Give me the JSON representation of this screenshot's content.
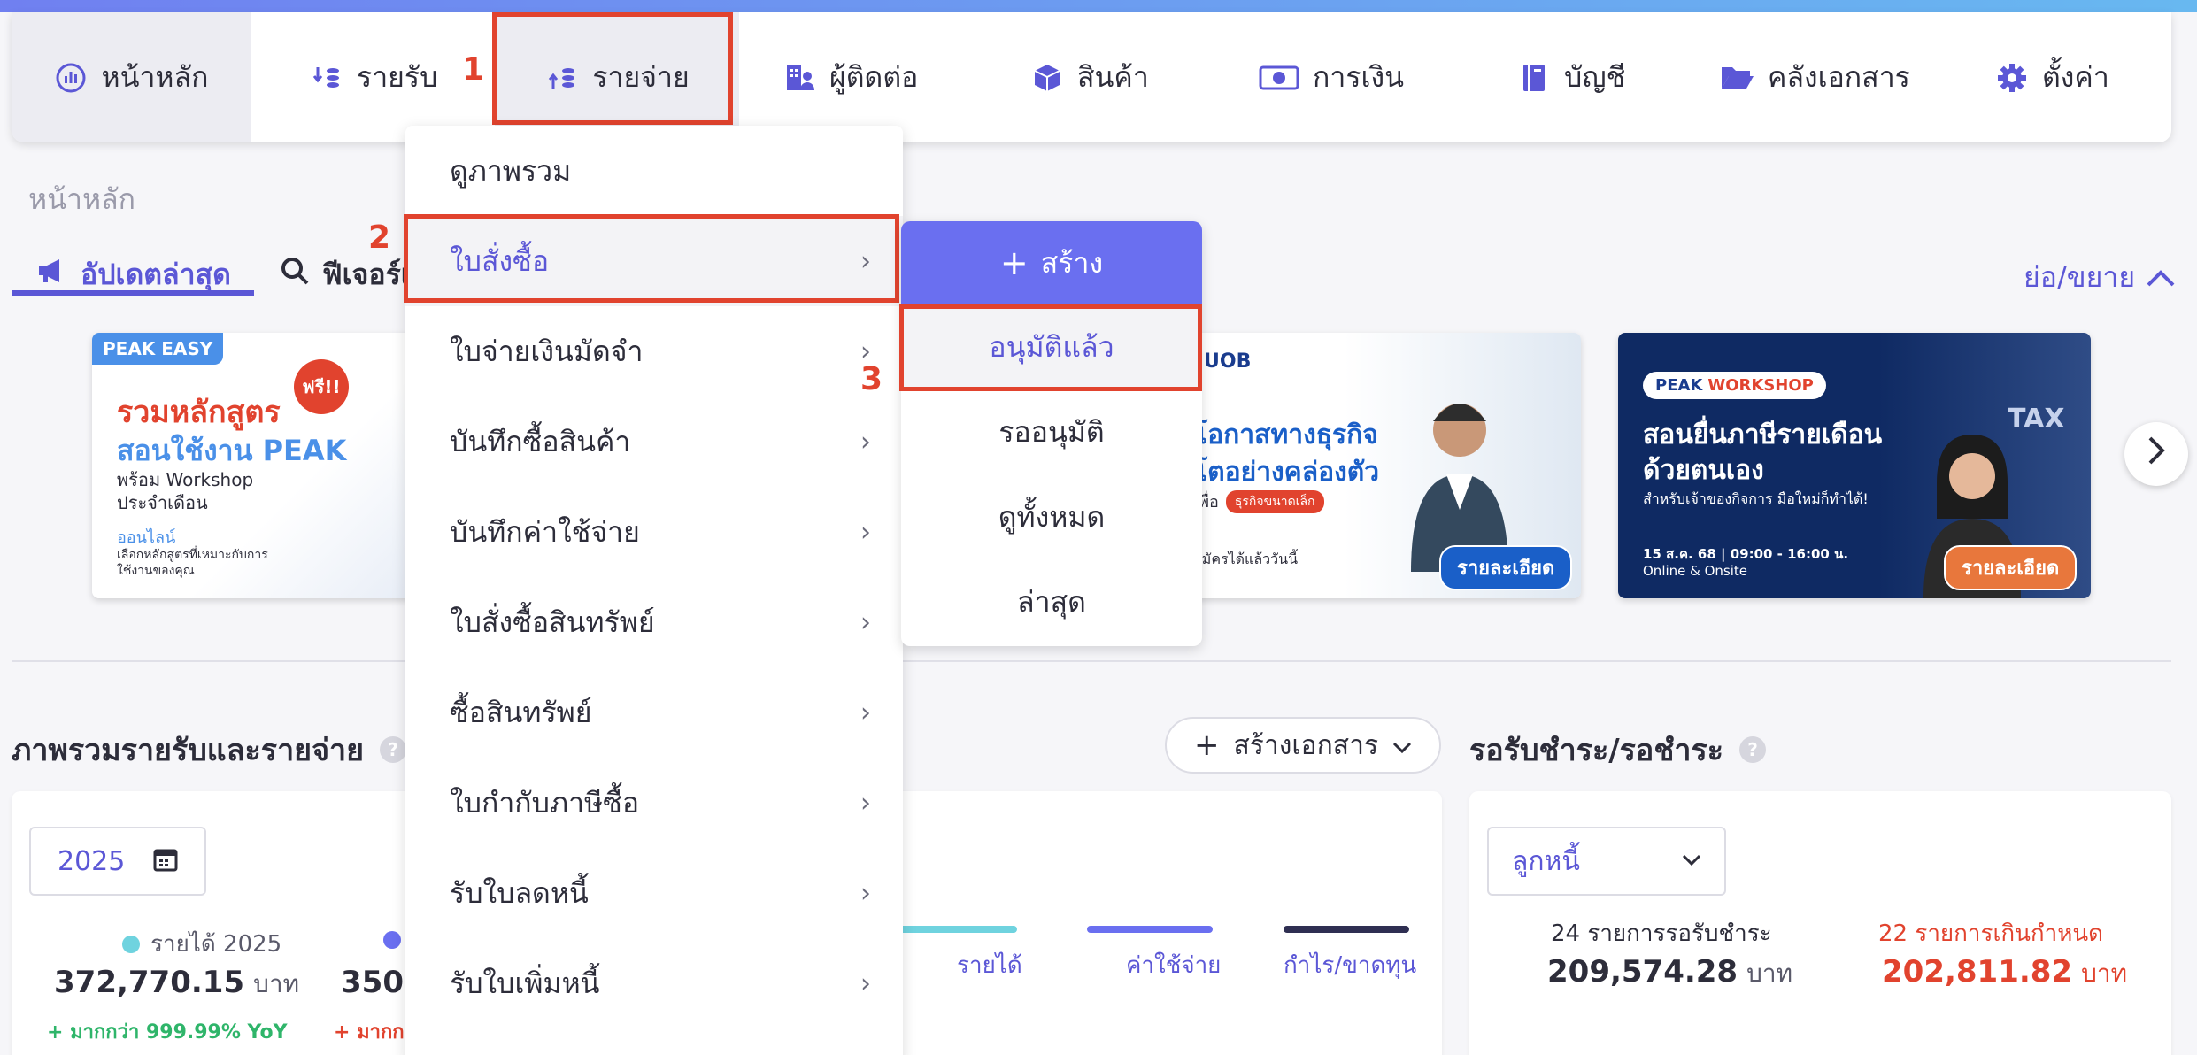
{
  "nav": {
    "home": "หน้าหลัก",
    "income": "รายรับ",
    "expense": "รายจ่าย",
    "contacts": "ผู้ติดต่อ",
    "products": "สินค้า",
    "finance": "การเงิน",
    "accounts": "บัญชี",
    "documents": "คลังเอกสาร",
    "settings": "ตั้งค่า"
  },
  "markers": [
    "1",
    "2",
    "3"
  ],
  "breadcrumb": "หน้าหลัก",
  "tabs": {
    "updates": "อัปเดตล่าสุด",
    "features": "ฟีเจอร์เ"
  },
  "collapse_label": "ย่อ/ขยาย",
  "banners": {
    "b1": {
      "tag": "PEAK EASY",
      "free": "ฟรี!!",
      "title1": "รวมหลักสูตร",
      "title2": "สอนใช้งาน PEAK",
      "sub1": "พร้อม Workshop",
      "sub2": "ประจำเดือน",
      "online": "ออนไลน์",
      "desc1": "เลือกหลักสูตรที่เหมาะกับการ",
      "desc2": "ใช้งานของคุณ"
    },
    "b3": {
      "logo": "UOB",
      "line1": "โอกาสทางธุรกิจ",
      "line2": "โตอย่างคล่องตัว",
      "line3": "เพื่อ",
      "pill": "ธุรกิจขนาดเล็ก",
      "line4": "สมัครได้แล้ววันนี้",
      "detail": "รายละเอียด"
    },
    "b4": {
      "tag_peak": "PEAK",
      "tag_ws": "WORKSHOP",
      "title1": "สอนยื่นภาษีรายเดือน",
      "title2": "ด้วยตนเอง",
      "sub": "สำหรับเจ้าของกิจการ มือใหม่ก็ทำได้!",
      "date": "15 ส.ค. 68 | 09:00 - 16:00 น.",
      "mode": "Online & Onsite",
      "detail": "รายละเอียด",
      "tax": "TAX"
    }
  },
  "expense_menu": {
    "items": [
      "ดูภาพรวม",
      "ใบสั่งซื้อ",
      "ใบจ่ายเงินมัดจำ",
      "บันทึกซื้อสินค้า",
      "บันทึกค่าใช้จ่าย",
      "ใบสั่งซื้อสินทรัพย์",
      "ซื้อสินทรัพย์",
      "ใบกำกับภาษีซื้อ",
      "รับใบลดหนี้",
      "รับใบเพิ่มหนี้"
    ]
  },
  "submenu": {
    "create": "สร้าง",
    "approved": "อนุมัติแล้ว",
    "pending": "รออนุมัติ",
    "view_all": "ดูทั้งหมด",
    "latest": "ล่าสุด"
  },
  "overview": {
    "title": "ภาพรวมรายรับและรายจ่าย",
    "year": "2025",
    "income_label": "รายได้ 2025",
    "income_value": "372,770.15",
    "expense_value": "350,",
    "unit": "บาท",
    "income_yoy": "+ มากกว่า 999.99% YoY",
    "expense_yoy": "+ มากกว",
    "legend": [
      "รายได้",
      "ค่าใช้จ่าย",
      "กำไร/ขาดทุน"
    ],
    "create_doc": "สร้างเอกสาร"
  },
  "receivable": {
    "title": "รอรับชำระ/รอชำระ",
    "select": "ลูกหนี้",
    "pending_label": "24 รายการรอรับชำระ",
    "pending_value": "209,574.28",
    "overdue_label": "22 รายการเกินกำหนด",
    "overdue_value": "202,811.82",
    "unit": "บาท"
  },
  "colors": {
    "primary": "#5b57d6",
    "highlight": "#e1432e",
    "income": "#6fd3df",
    "expense": "#6a6ff0",
    "profit": "#2f2f52",
    "positive": "#2fb56a",
    "negative": "#e1432e"
  }
}
